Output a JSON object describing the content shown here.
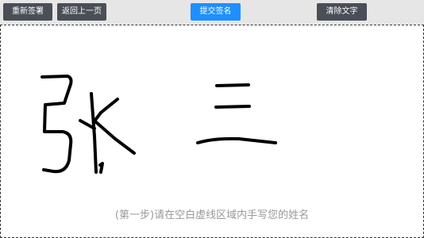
{
  "toolbar": {
    "reset_label": "重新签署",
    "back_label": "返回上一页",
    "submit_label": "提交签名",
    "clear_label": "清除文字"
  },
  "canvas": {
    "hint": "(第一步)请在空白虚线区域内手写您的姓名"
  },
  "colors": {
    "dark_button": "#4a4e57",
    "primary_button": "#1e8fff",
    "hint_text": "#999999"
  }
}
